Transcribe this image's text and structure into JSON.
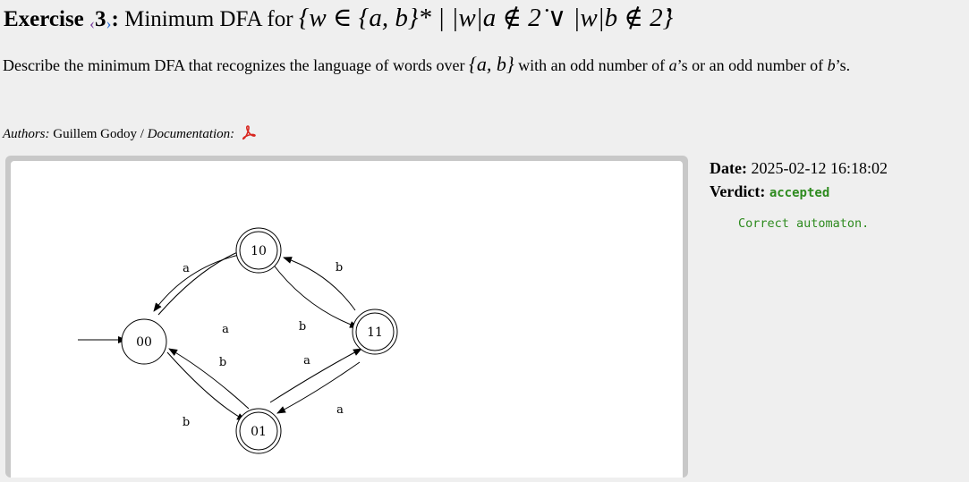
{
  "title": {
    "prefix": "Exercise",
    "number": "3",
    "colon": ":",
    "name": "Minimum DFA for",
    "formula": "{w ∈ {a, b}* | |w|a ∉ 2̇ ∨ |w|b ∉ 2̇}"
  },
  "description": {
    "text1": "Describe the minimum DFA that recognizes the language of words over ",
    "alphabet": "{a, b}",
    "text2": " with an odd number of ",
    "sym_a": "a",
    "text3": "’s or an odd number of ",
    "sym_b": "b",
    "text4": "’s."
  },
  "authors": {
    "label": "Authors:",
    "names": "Guillem Godoy",
    "sep": " / ",
    "doc_label": "Documentation:",
    "doc_icon": "pdf-icon"
  },
  "automaton": {
    "states": [
      "00",
      "10",
      "01",
      "11"
    ],
    "initial": "00",
    "accepting": [
      "10",
      "01",
      "11"
    ],
    "transitions": [
      {
        "from": "00",
        "to": "10",
        "label": "a"
      },
      {
        "from": "10",
        "to": "00",
        "label": "a"
      },
      {
        "from": "00",
        "to": "01",
        "label": "b"
      },
      {
        "from": "01",
        "to": "00",
        "label": "b"
      },
      {
        "from": "10",
        "to": "11",
        "label": "b"
      },
      {
        "from": "11",
        "to": "10",
        "label": "b"
      },
      {
        "from": "01",
        "to": "11",
        "label": "a"
      },
      {
        "from": "11",
        "to": "01",
        "label": "a"
      }
    ]
  },
  "meta": {
    "date_label": "Date:",
    "date_value": "2025-02-12 16:18:02",
    "verdict_label": "Verdict:",
    "verdict_value": "accepted",
    "verdict_color": "#2e8b1f",
    "message": "Correct automaton."
  }
}
